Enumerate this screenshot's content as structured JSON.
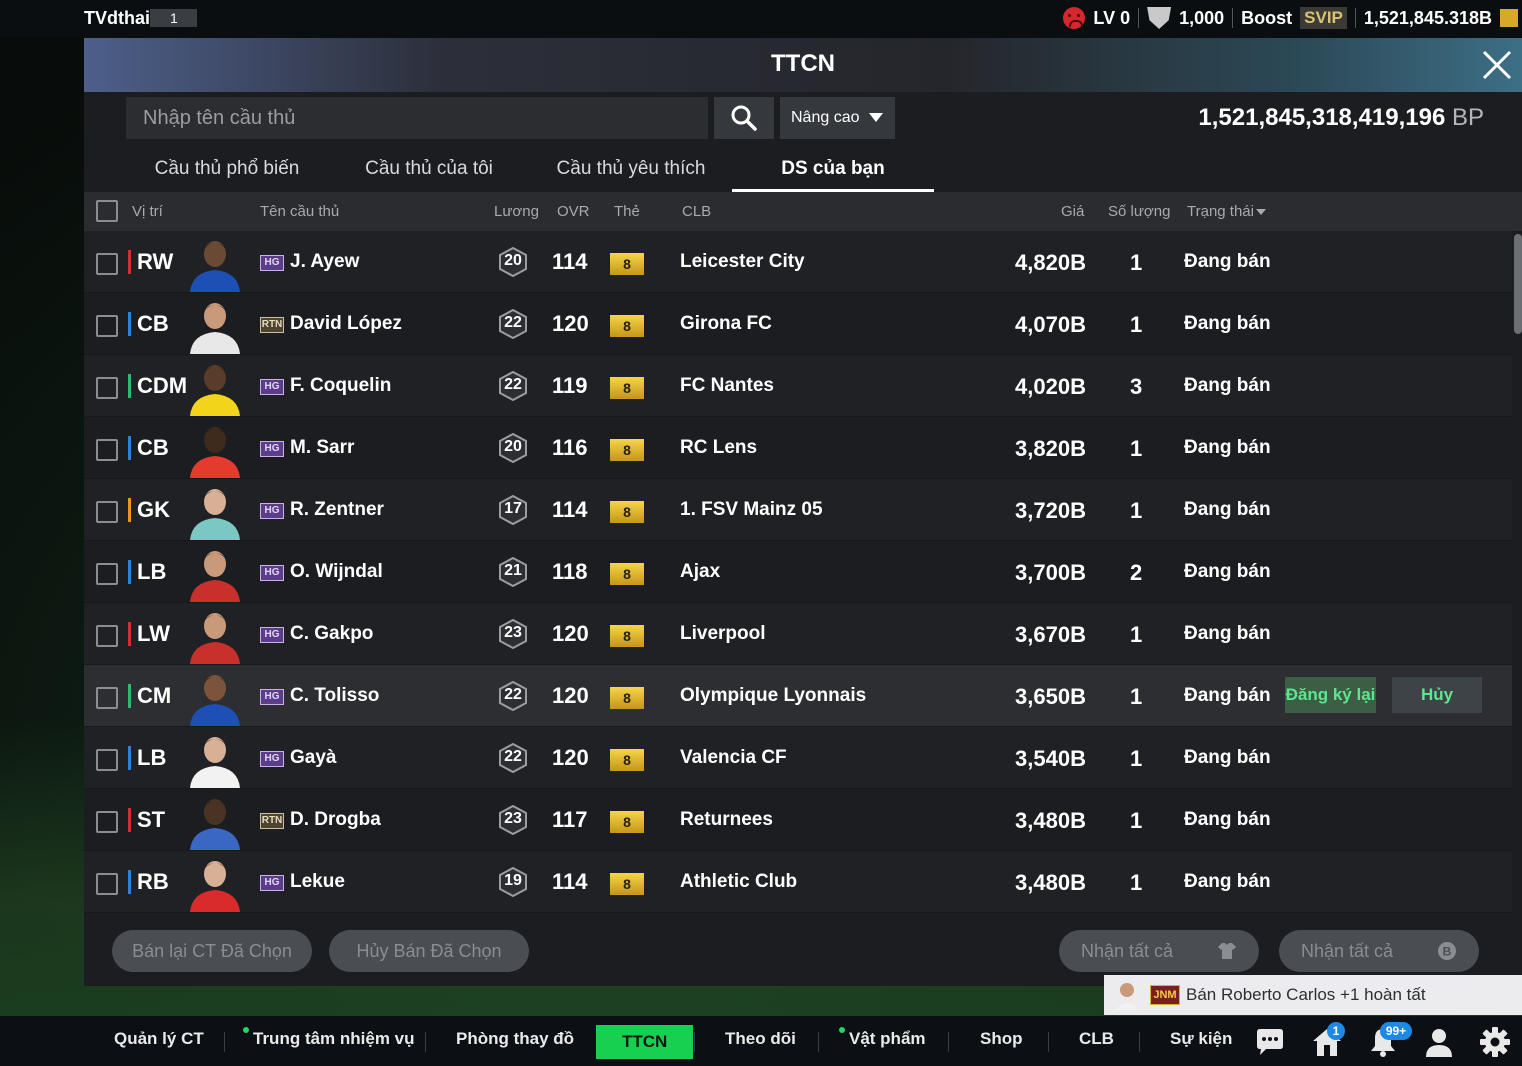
{
  "topbar": {
    "username": "TVdthai",
    "rank": "1",
    "level": "LV 0",
    "shield_count": "1,000",
    "boost": "Boost",
    "svip": "SVIP",
    "bp_short": "1,521,845.318B"
  },
  "panel": {
    "title": "TTCN",
    "search_placeholder": "Nhập tên cầu thủ",
    "advanced": "Nâng cao",
    "balance": "1,521,845,318,419,196",
    "balance_unit": "BP"
  },
  "tabs": [
    "Cầu thủ phổ biến",
    "Cầu thủ của tôi",
    "Cầu thủ yêu thích",
    "DS của bạn"
  ],
  "active_tab": "DS của bạn",
  "columns": {
    "pos": "Vị trí",
    "name": "Tên cầu thủ",
    "salary": "Lương",
    "ovr": "OVR",
    "card": "Thẻ",
    "club": "CLB",
    "price": "Giá",
    "qty": "Số lượng",
    "status": "Trạng thái"
  },
  "rows": [
    {
      "pos": "RW",
      "season": "HG",
      "name": "J. Ayew",
      "salary": "20",
      "ovr": "114",
      "card": "8",
      "club": "Leicester City",
      "price": "4,820B",
      "qty": "1",
      "status": "Đang bán"
    },
    {
      "pos": "CB",
      "season": "RTN",
      "name": "David López",
      "salary": "22",
      "ovr": "120",
      "card": "8",
      "club": "Girona FC",
      "price": "4,070B",
      "qty": "1",
      "status": "Đang bán"
    },
    {
      "pos": "CDM",
      "season": "HG",
      "name": "F. Coquelin",
      "salary": "22",
      "ovr": "119",
      "card": "8",
      "club": "FC Nantes",
      "price": "4,020B",
      "qty": "3",
      "status": "Đang bán"
    },
    {
      "pos": "CB",
      "season": "HG",
      "name": "M. Sarr",
      "salary": "20",
      "ovr": "116",
      "card": "8",
      "club": "RC Lens",
      "price": "3,820B",
      "qty": "1",
      "status": "Đang bán"
    },
    {
      "pos": "GK",
      "season": "HG",
      "name": "R. Zentner",
      "salary": "17",
      "ovr": "114",
      "card": "8",
      "club": "1. FSV Mainz 05",
      "price": "3,720B",
      "qty": "1",
      "status": "Đang bán"
    },
    {
      "pos": "LB",
      "season": "HG",
      "name": "O. Wijndal",
      "salary": "21",
      "ovr": "118",
      "card": "8",
      "club": "Ajax",
      "price": "3,700B",
      "qty": "2",
      "status": "Đang bán"
    },
    {
      "pos": "LW",
      "season": "HG",
      "name": "C. Gakpo",
      "salary": "23",
      "ovr": "120",
      "card": "8",
      "club": "Liverpool",
      "price": "3,670B",
      "qty": "1",
      "status": "Đang bán"
    },
    {
      "pos": "CM",
      "season": "HG",
      "name": "C. Tolisso",
      "salary": "22",
      "ovr": "120",
      "card": "8",
      "club": "Olympique Lyonnais",
      "price": "3,650B",
      "qty": "1",
      "status": "Đang bán"
    },
    {
      "pos": "LB",
      "season": "HG",
      "name": "Gayà",
      "salary": "22",
      "ovr": "120",
      "card": "8",
      "club": "Valencia CF",
      "price": "3,540B",
      "qty": "1",
      "status": "Đang bán"
    },
    {
      "pos": "ST",
      "season": "RTN",
      "name": "D. Drogba",
      "salary": "23",
      "ovr": "117",
      "card": "8",
      "club": "Returnees",
      "price": "3,480B",
      "qty": "1",
      "status": "Đang bán"
    },
    {
      "pos": "RB",
      "season": "HG",
      "name": "Lekue",
      "salary": "19",
      "ovr": "114",
      "card": "8",
      "club": "Athletic Club",
      "price": "3,480B",
      "qty": "1",
      "status": "Đang bán"
    }
  ],
  "row_actions": {
    "relist": "Đăng ký lại",
    "cancel": "Hủy"
  },
  "bottom_buttons": {
    "resell_selected": "Bán lại CT Đã Chọn",
    "cancel_selected": "Hủy Bán Đã Chọn",
    "claim_all_1": "Nhận tất cả",
    "claim_all_2": "Nhận tất cả"
  },
  "toast": {
    "badge": "JNM",
    "text": "Bán Roberto Carlos +1 hoàn tất"
  },
  "nav": [
    "Quản lý CT",
    "Trung tâm nhiệm vụ",
    "Phòng thay đồ",
    "TTCN",
    "Theo dõi",
    "Vật phẩm",
    "Shop",
    "CLB",
    "Sự kiện"
  ],
  "nav_badges": {
    "home": "1",
    "notifications": "99+"
  },
  "colors": {
    "accent_green": "#18d050",
    "gold_card": "#e8c23a",
    "status_green": "#5ee58f",
    "position_red": "#d32f2f"
  }
}
